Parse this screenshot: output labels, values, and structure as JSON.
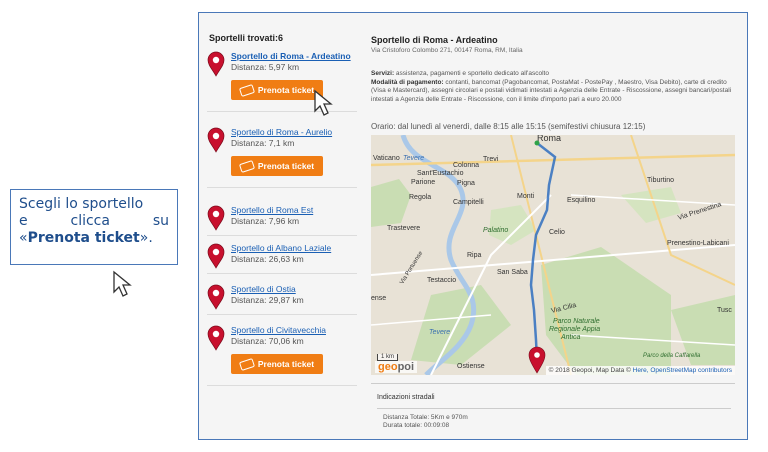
{
  "callout": {
    "line1": "Scegli lo sportello",
    "line2_a": "e",
    "line2_b": "clicca",
    "line2_c": "su",
    "line3_open": "«",
    "line3_bold": "Prenota ticket",
    "line3_close": "»."
  },
  "list": {
    "title": "Sportelli trovati:6",
    "button_label": "Prenota ticket",
    "items": [
      {
        "name": "Sportello di Roma - Ardeatino",
        "distance": "Distanza: 5,97 km",
        "has_button": true,
        "bold": true
      },
      {
        "name": "Sportello di Roma - Aurelio",
        "distance": "Distanza: 7,1 km",
        "has_button": true
      },
      {
        "name": "Sportello di Roma Est",
        "distance": "Distanza: 7,96 km",
        "has_button": false
      },
      {
        "name": "Sportello di Albano Laziale",
        "distance": "Distanza: 26,63 km",
        "has_button": false
      },
      {
        "name": "Sportello di Ostia",
        "distance": "Distanza: 29,87 km",
        "has_button": false
      },
      {
        "name": "Sportello di Civitavecchia",
        "distance": "Distanza: 70,06 km",
        "has_button": true
      }
    ]
  },
  "detail": {
    "title": "Sportello di Roma - Ardeatino",
    "address": "Via Cristoforo Colombo 271, 00147 Roma, RM, Italia",
    "services_label": "Servizi:",
    "services": " assistenza, pagamenti e sportello dedicato all'ascolto",
    "payment_label": "Modalità di pagamento:",
    "payment": " contanti, bancomat (Pagobancomat, PostaMat - PostePay , Maestro, Visa Debito), carte di credito (Visa e Mastercard), assegni circolari e postali vidimati intestati a Agenzia delle Entrate - Riscossione, assegni bancari/postali intestati a Agenzia delle Entrate - Riscossione, con il limite d'importo pari a euro 20.000",
    "hours": "Orario: dal lunedì al venerdì, dalle 8:15 alle 15:15 (semifestivi chiusura 12:15)"
  },
  "map": {
    "labels": {
      "vaticano": "Vaticano",
      "tevere1": "Tevere",
      "trevi": "Trevi",
      "roma": "Roma",
      "colonna": "Colonna",
      "santeustachio": "Sant'Eustachio",
      "parione": "Parione",
      "pigna": "Pigna",
      "tiburtino": "Tiburtino",
      "regola": "Regola",
      "campitelli": "Campitelli",
      "monti": "Monti",
      "esquilino": "Esquilino",
      "prenestina": "Via Prenestina",
      "trastevere": "Trastevere",
      "palatino": "Palatino",
      "celio": "Celio",
      "prenestino": "Prenestino-Labicani",
      "portuense": "Via Portuense",
      "ripa": "Ripa",
      "sansaba": "San Saba",
      "testaccio": "Testaccio",
      "ense": "ense",
      "tevere2": "Tevere",
      "viacilia": "Via Cilia",
      "parco1": "Parco Naturale",
      "parco2": "Regionale Appia",
      "parco3": "Antica",
      "tusc": "Tusc",
      "caffarella": "Parco della Caffarella",
      "ostiense": "Ostiense",
      "scale": "1 km",
      "geo_a": "geo",
      "geo_b": "poi"
    },
    "attribution_a": "© 2018 Geopoi, Map Data © ",
    "attribution_here": "Here",
    "attribution_osm": ", OpenStreetMap contributors"
  },
  "routing": {
    "title": "Indicazioni stradali",
    "distance": "Distanza Totale: 5Km e 970m",
    "duration": "Durata totale: 00:09:08"
  },
  "colors": {
    "accent": "#f07d14",
    "link": "#1a5fb4",
    "pin": "#c8102e",
    "route": "#2f6fbf"
  }
}
